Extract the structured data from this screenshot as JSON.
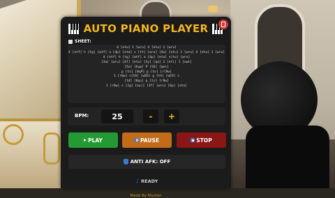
{
  "panel": {
    "title": "AUTO PIANO PLAYER",
    "sheet_label": "SHEET:",
    "sheet_lines": [
      "4 [etu] 1 [wru] 4 [etu] 1 [wru]",
      "4 [etf] h [tg] [wtf] a [4p] [eta] s [tt] [wru] [4u] [etu] 1 [wru] 4 [etu] 1 [wru]",
      "4 [etf] h [tg] [wtf] a [4p] [eta] s[to] [wru]",
      "[3a] [wru] [6f] [etu] [2y] [qa] 2 [eti] 1 [uwt]",
      "[5o] [Ewp] P [t6] [qes]",
      "p [ts] [8qP] p [ts] [rl9w]",
      "1 [r0w] s[t6] [wED] g [th] [wE9] s",
      "[td] [8qs] p [ts] [r9w]",
      "1 [r0w] s [2g] [eyi] [3f] [wru] [6p] [eto]"
    ],
    "bpm_label": "BPM:",
    "bpm_value": "25",
    "bpm_minus": "-",
    "bpm_plus": "+",
    "play_label": "PLAY",
    "pause_label": "PAUSE",
    "stop_label": "STOP",
    "afk_label": "ANTI AFK: OFF",
    "status_label": "READY",
    "footer": "Made By Myolan"
  },
  "colors": {
    "title": "#f2b51c",
    "play": "#239a34",
    "pause": "#c26c1a",
    "stop": "#8a1616",
    "close": "#d23636",
    "panel_bg": "#1b1b1b"
  },
  "icons": {
    "title_left": "piano-keys-icon",
    "title_right": "piano-keys-icon",
    "close": "close-icon",
    "sheet": "checkbox-icon",
    "play": "play-icon",
    "pause": "pause-icon",
    "stop": "stop-icon",
    "afk": "shield-icon",
    "status": "music-note-icon"
  }
}
